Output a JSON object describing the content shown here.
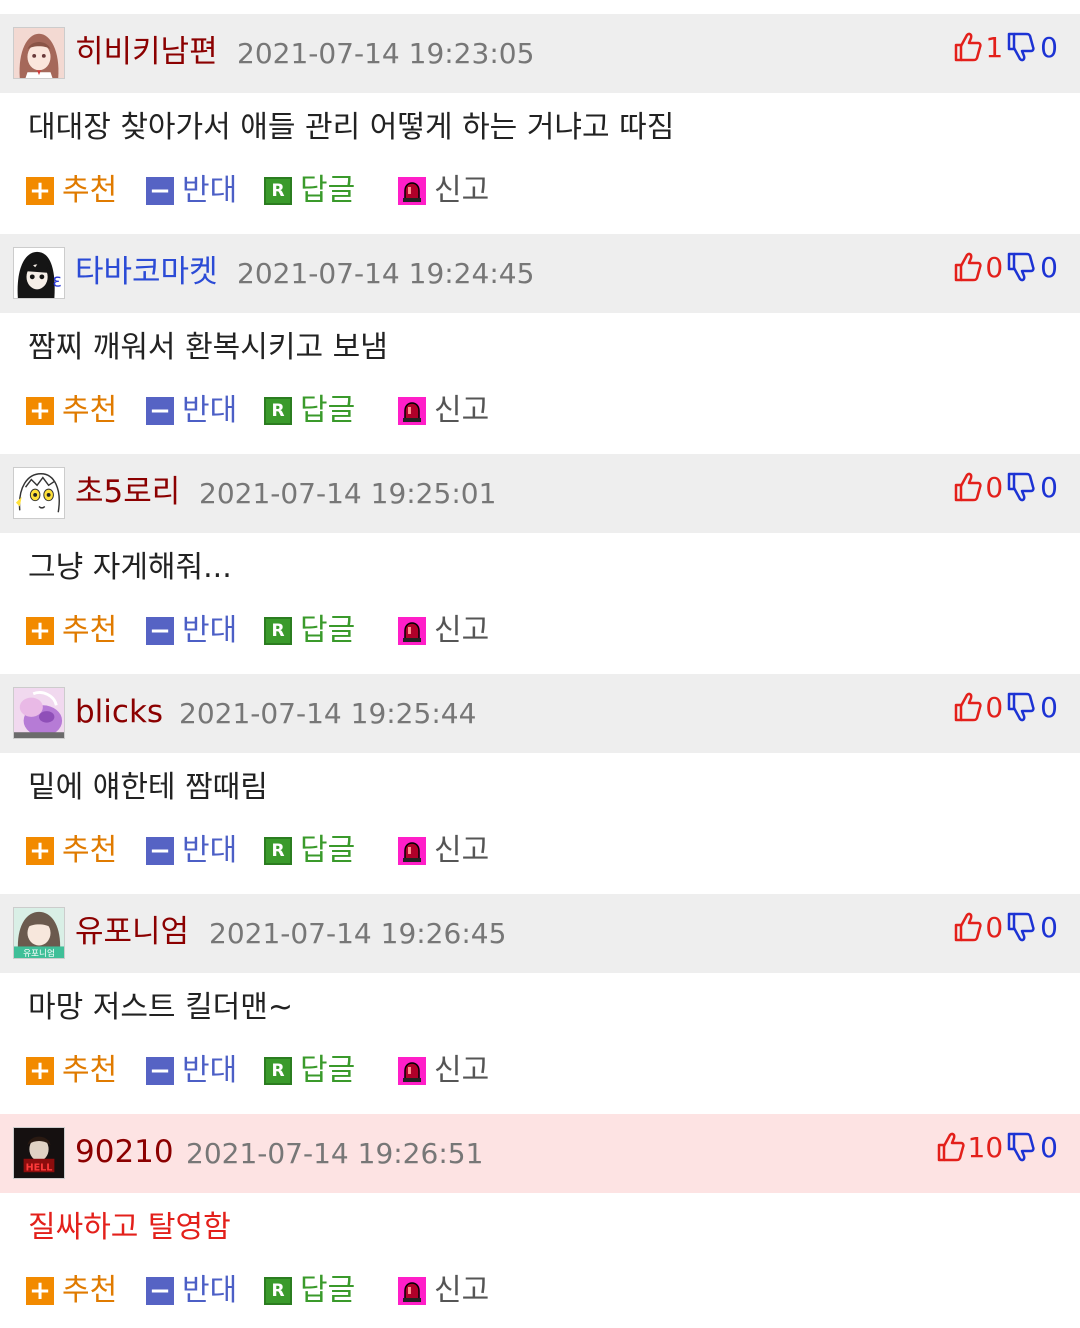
{
  "actions": {
    "recommend": "추천",
    "oppose": "반대",
    "reply": "답글",
    "report": "신고",
    "reply_badge": "R"
  },
  "colors": {
    "header_bg": "#eeeeee",
    "best_header_bg": "#fde3e3",
    "nick": "#8b0000",
    "nick_blue": "#2b4bd6",
    "upvote": "#e3201b",
    "downvote": "#1c33d4"
  },
  "comments": [
    {
      "nickname": "히비키남편",
      "date": "2021-07-14 19:23:05",
      "upvotes": "1",
      "downvotes": "0",
      "text": "대대장 찾아가서 애들 관리 어떻게 하는 거냐고 따짐",
      "avatar": "anime-girl-avatar"
    },
    {
      "nickname": "타바코마켓",
      "date": "2021-07-14 19:24:45",
      "upvotes": "0",
      "downvotes": "0",
      "text": "짬찌 깨워서 환복시키고 보냄",
      "avatar": "dark-hair-character-avatar"
    },
    {
      "nickname": "초5로리",
      "date": "2021-07-14 19:25:01",
      "upvotes": "0",
      "downvotes": "0",
      "text": "그냥 자게해줘...",
      "avatar": "sketch-character-avatar"
    },
    {
      "nickname": "blicks",
      "date": "2021-07-14 19:25:44",
      "upvotes": "0",
      "downvotes": "0",
      "text": "밑에 얘한테 짬때림",
      "avatar": "purple-character-avatar"
    },
    {
      "nickname": "유포니엄",
      "date": "2021-07-14 19:26:45",
      "upvotes": "0",
      "downvotes": "0",
      "text": "마망 저스트 킬더맨~",
      "avatar": "green-character-avatar"
    },
    {
      "nickname": "90210",
      "date": "2021-07-14 19:26:51",
      "upvotes": "10",
      "downvotes": "0",
      "text": "질싸하고 탈영함",
      "avatar": "red-dark-avatar"
    }
  ]
}
